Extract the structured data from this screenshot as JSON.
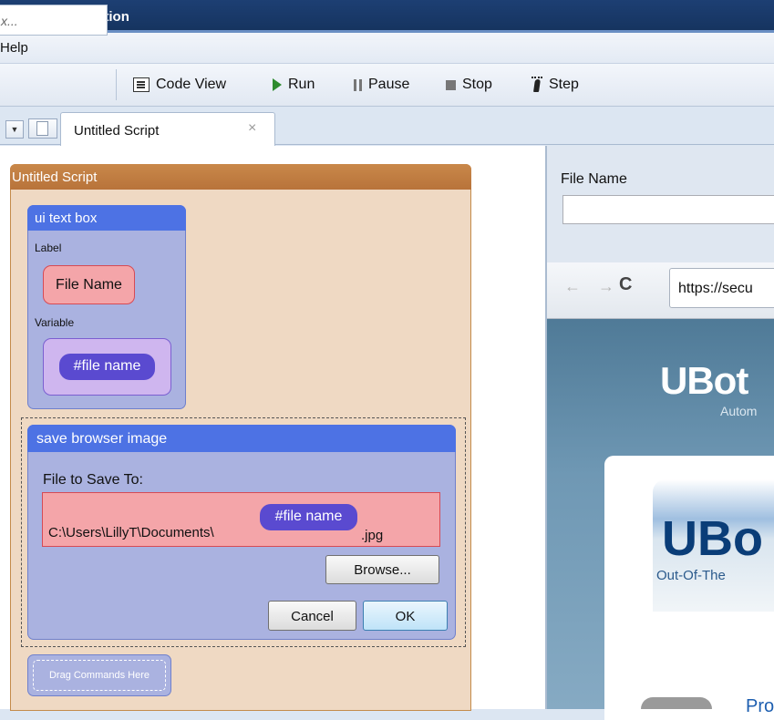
{
  "window": {
    "title": "o Developer Edition"
  },
  "menu": {
    "help": "Help"
  },
  "toolbar": {
    "search_placeholder": "x...",
    "code_view": "Code View",
    "run": "Run",
    "pause": "Pause",
    "stop": "Stop",
    "step": "Step"
  },
  "tabs": [
    {
      "label": "Untitled Script",
      "close": "×"
    }
  ],
  "script": {
    "title": "Untitled Script",
    "ui_text_box": {
      "header": "ui text box",
      "label_caption": "Label",
      "label_value": "File Name",
      "variable_caption": "Variable",
      "variable_value": "#file name"
    },
    "save_browser_image": {
      "header": "save browser image",
      "file_caption": "File to Save To:",
      "path_prefix": "C:\\Users\\LillyT\\Documents\\",
      "path_variable": "#file name",
      "path_suffix": ".jpg",
      "browse": "Browse...",
      "cancel": "Cancel",
      "ok": "OK"
    },
    "drag_hint": "Drag Commands Here"
  },
  "preview": {
    "file_label": "File Name",
    "file_value": "",
    "url": "https://secu",
    "logo_text": "UBot",
    "tagline": "Autom",
    "banner_logo": "UBo",
    "banner_tagline": "Out-Of-The",
    "link_text": "Pro"
  }
}
